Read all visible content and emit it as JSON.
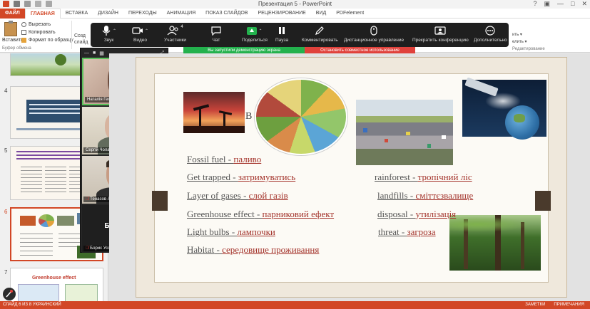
{
  "window": {
    "title": "Презентация 5 - PowerPoint",
    "controls": [
      "?",
      "▣",
      "—",
      "□",
      "✕"
    ]
  },
  "ribbon_tabs": [
    "ФАЙЛ",
    "ГЛАВНАЯ",
    "ВСТАВКА",
    "ДИЗАЙН",
    "ПЕРЕХОДЫ",
    "АНИМАЦИЯ",
    "ПОКАЗ СЛАЙДОВ",
    "РЕЦЕНЗИРОВАНИЕ",
    "ВИД",
    "PDFelement"
  ],
  "clipboard": {
    "paste": "Вставить",
    "cut": "Вырезать",
    "copy": "Копировать",
    "format_painter": "Формат по образцу",
    "group": "Буфер обмена",
    "create": "Созд\nслайд"
  },
  "ribbon_right": {
    "line1": "ить ▾",
    "line2": "елить ▾",
    "group": "Редактирование"
  },
  "zoom_toolbar": {
    "items": [
      {
        "label": "Звук",
        "icon": "microphone-icon"
      },
      {
        "label": "Видео",
        "icon": "video-camera-icon"
      },
      {
        "label": "Участники",
        "icon": "participants-icon",
        "badge": "4"
      },
      {
        "label": "Чат",
        "icon": "chat-icon"
      },
      {
        "label": "Поделиться",
        "icon": "share-screen-icon"
      },
      {
        "label": "Пауза",
        "icon": "pause-icon"
      },
      {
        "label": "Комментировать",
        "icon": "annotate-pen-icon"
      },
      {
        "label": "Дистанционное управление",
        "icon": "mouse-icon"
      },
      {
        "label": "Прекратить конференцию",
        "icon": "end-meeting-icon"
      },
      {
        "label": "Дополнительно",
        "icon": "more-icon"
      }
    ],
    "sharing_notice": "Вы запустили демонстрацию экрана",
    "stop_sharing": "Остановить совместное использование"
  },
  "participants": [
    {
      "name": "Наталія Георгіївна",
      "muted": false
    },
    {
      "name": "Сергій Чолак",
      "muted": false
    },
    {
      "name": "Тенасов Артем Сергеевич",
      "muted": true
    },
    {
      "name": "Борис Усов",
      "muted": true,
      "video_off": true
    }
  ],
  "slide_thumbs": [
    {
      "num": "4"
    },
    {
      "num": "5"
    },
    {
      "num": "6"
    },
    {
      "num": "7",
      "title": "Greenhouse effect"
    }
  ],
  "slide": {
    "title_fragment": "B",
    "vocab_left": [
      {
        "en": "Fossil fuel",
        "ua": "паливо"
      },
      {
        "en": "Get trapped",
        "ua": "затримуватись"
      },
      {
        "en": "Layer of gases",
        "ua": "слой газів"
      },
      {
        "en": "Greenhouse effect",
        "ua": "парниковий ефект"
      },
      {
        "en": "Light bulbs",
        "ua": "лампочки"
      },
      {
        "en": "Habitat",
        "ua": "середовище проживання"
      }
    ],
    "vocab_right": [
      {
        "en": "rainforest",
        "ua": "тропічний ліс"
      },
      {
        "en": "landfills",
        "ua": "сміттєзвалище"
      },
      {
        "en": "disposal",
        "ua": "утилізація"
      },
      {
        "en": "threat",
        "ua": "загроза"
      }
    ]
  },
  "statusbar": {
    "left": "СЛАЙД 6 ИЗ 8      УКРАИНСКИЙ",
    "notes": "ЗАМЕТКИ",
    "comments": "ПРИМЕЧАНИЯ"
  },
  "colors": {
    "accent": "#d24726",
    "zoom_green": "#23b14d",
    "zoom_red": "#e0413b",
    "translation": "#a3322a"
  }
}
